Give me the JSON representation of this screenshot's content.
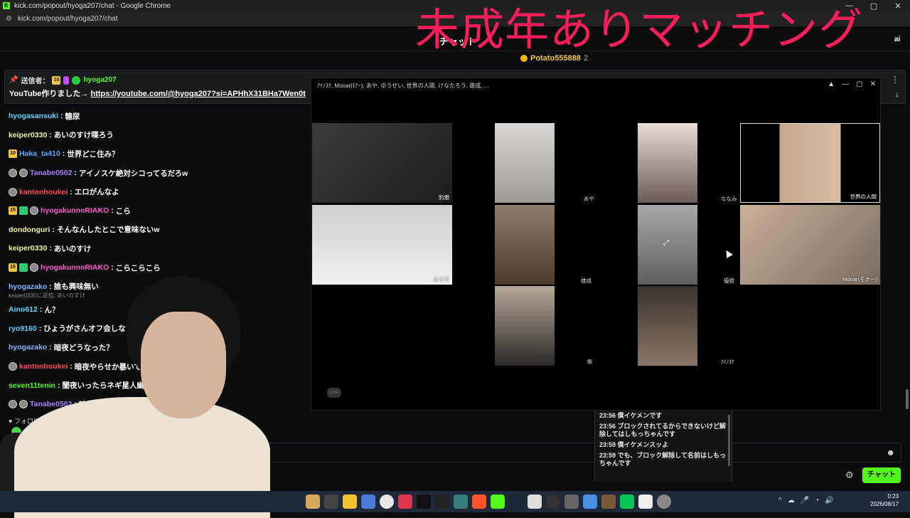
{
  "browser": {
    "window_title": "kick.com/popout/hyoga207/chat - Google Chrome",
    "url": "kick.com/popout/hyoga207/chat"
  },
  "chat_header": {
    "title": "チャット",
    "right_text": "ai"
  },
  "overlay": {
    "title": "未成年ありマッチング",
    "color": "#ff1e5a"
  },
  "leaderboard": {
    "user": "Potato555888",
    "count": "2"
  },
  "pinned": {
    "prefix": "送信者：",
    "badge": "10",
    "user": "hyoga207",
    "text": "YouTube作りました→ ",
    "link": "https://youtube.com/@hyoga207?si=APHhX31BHa7Wen0t"
  },
  "messages": [
    {
      "badges": [],
      "user": "hyogasansuki",
      "color": "#5ad4ff",
      "text": "糖尿"
    },
    {
      "badges": [],
      "user": "keiper0330",
      "color": "#f2f59a",
      "text": "あいのすけ喋ろう"
    },
    {
      "badges": [
        "10"
      ],
      "user": "Haka_ta410",
      "color": "#5aa9ff",
      "text": "世界どこ住み？"
    },
    {
      "badges": [
        "circ",
        "circ"
      ],
      "user": "Tanabe0502",
      "color": "#b07cff",
      "text": "アイノスケ絶対シコってるだろw"
    },
    {
      "badges": [
        "circ"
      ],
      "user": "kantonhoukei",
      "color": "#ff4b5c",
      "text": "エロがんなよ"
    },
    {
      "badges": [
        "15",
        "mod",
        "circ"
      ],
      "user": "hyogakunnoRIAKO",
      "color": "#ff5ad1",
      "text": "こら"
    },
    {
      "badges": [],
      "user": "dondonguri",
      "color": "#f2f59a",
      "text": "そんなんしたとこで意味ないw"
    },
    {
      "badges": [],
      "user": "keiper0330",
      "color": "#f2f59a",
      "text": "あいのすけ"
    },
    {
      "badges": [
        "15",
        "mod",
        "circ"
      ],
      "user": "hyogakunnoRIAKO",
      "color": "#ff5ad1",
      "text": "こらこらこら"
    },
    {
      "badges": [],
      "user": "hyogazako",
      "color": "#8ab4ff",
      "text": "誰も興味無い"
    },
    {
      "badges": [],
      "user": "Aino612",
      "color": "#5ad4ff",
      "text": "ん？",
      "reply": "keiper0330に返信: あいのすけ"
    },
    {
      "badges": [],
      "user": "ryo9160",
      "color": "#5ad4ff",
      "text": "ひょうがさんオフ会しないの"
    },
    {
      "badges": [],
      "user": "hyogazako",
      "color": "#8ab4ff",
      "text": "暗夜どうなった？"
    },
    {
      "badges": [
        "circ"
      ],
      "user": "kantonhoukei",
      "color": "#ff4b5c",
      "text": "暗夜やらせか暴いて"
    },
    {
      "badges": [],
      "user": "seven11tenin",
      "color": "#53fc18",
      "text": "闇夜いったらネギ星人幽霊"
    },
    {
      "badges": [
        "circ",
        "circ"
      ],
      "user": "Tanabe0502",
      "color": "#b07cff",
      "text": "暗夜はネギ星人が適化"
    }
  ],
  "followers_only": "フォロワーのみ",
  "send_button": "チャット",
  "call": {
    "title": "ｱｲﾉｽｹ, Monar(ﾓﾅｰ), あや, ゆうせい, 世界の人間, けなたろう, 雄成, ...",
    "tiles": [
      {
        "label": "豹雅"
      },
      {
        "label": "あや"
      },
      {
        "label": "ななみ"
      },
      {
        "label": "世界の人間"
      },
      {
        "label": "みさき"
      },
      {
        "label": "雄成"
      },
      {
        "label": "優樹"
      },
      {
        "label": "Monar(モナー)"
      },
      {
        "label": "魚"
      },
      {
        "label": "ｱｲﾉｽｹ"
      }
    ],
    "logo": "LINE"
  },
  "side_chat": [
    {
      "time": "23:56",
      "text": "僕イケメンです"
    },
    {
      "time": "23:56",
      "text": "ブロックされてるからできないけど解除してはしもっちゃんです"
    },
    {
      "time": "23:59",
      "text": "僕イケメンスッよ"
    },
    {
      "time": "23:59",
      "text": "でも、ブロック解除して名前はしもっちゃんです"
    }
  ],
  "taskbar": {
    "time": "0:23",
    "date": "2026/08/17"
  }
}
